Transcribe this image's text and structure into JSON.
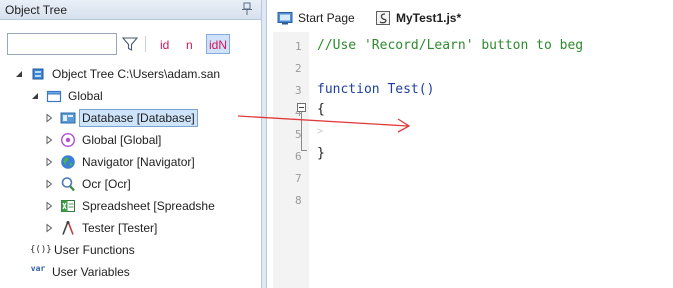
{
  "object_tree_panel": {
    "title": "Object Tree",
    "pin_icon": "pin-icon",
    "search": {
      "value": "",
      "placeholder": ""
    },
    "filter_icon": "filter-icon",
    "toolbar_buttons": {
      "id": "id",
      "n": "n",
      "id_n": "idN"
    },
    "tree": {
      "root": {
        "label": "Object Tree C:\\Users\\adam.san",
        "icon": "object-tree-icon"
      },
      "global": {
        "label": "Global",
        "icon": "folder-icon"
      },
      "children": [
        {
          "label": "Database [Database]",
          "icon": "database-icon",
          "selected": true
        },
        {
          "label": "Global [Global]",
          "icon": "global-icon"
        },
        {
          "label": "Navigator [Navigator]",
          "icon": "navigator-icon"
        },
        {
          "label": "Ocr [Ocr]",
          "icon": "ocr-icon"
        },
        {
          "label": "Spreadsheet [Spreadshe",
          "icon": "spreadsheet-icon"
        },
        {
          "label": "Tester [Tester]",
          "icon": "tester-icon"
        }
      ],
      "user_functions": {
        "label": "User Functions",
        "icon": "functions-icon",
        "icon_text": "{()}"
      },
      "user_variables": {
        "label": "User Variables",
        "icon": "variables-icon",
        "icon_text": "var"
      }
    }
  },
  "editor": {
    "tabs": [
      {
        "label": "Start Page",
        "icon": "start-page-icon"
      },
      {
        "label": "MyTest1.js*",
        "icon": "script-file-icon"
      }
    ],
    "line_numbers": [
      "1",
      "2",
      "3",
      "4",
      "5",
      "6",
      "7",
      "8"
    ],
    "code": {
      "line1": "//Use 'Record/Learn' button to beg",
      "line3_keyword": "function",
      "line3_rest": " Test()",
      "line4": "{",
      "line6": "}"
    }
  },
  "colors": {
    "selection": "#cde4fb",
    "toolbar_accent": "#d4145a",
    "comment": "#2e8b2e",
    "keyword": "#1f3f9f",
    "drag_arrow": "#e03a3a"
  }
}
